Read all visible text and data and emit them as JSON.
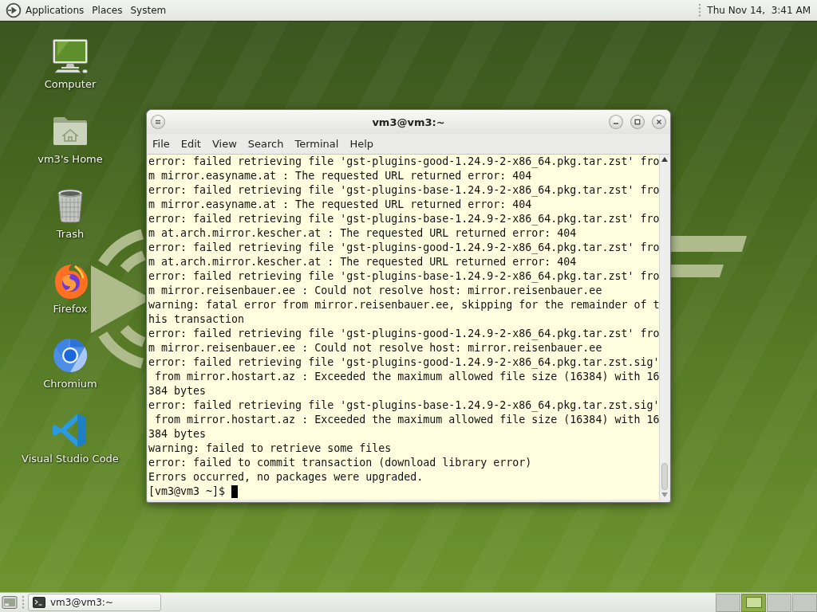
{
  "top_panel": {
    "menus": [
      "Applications",
      "Places",
      "System"
    ],
    "clock": "Thu Nov 14,  3:41 AM"
  },
  "desktop_icons": [
    {
      "kind": "computer",
      "label": "Computer"
    },
    {
      "kind": "home",
      "label": "vm3's Home"
    },
    {
      "kind": "trash",
      "label": "Trash"
    },
    {
      "kind": "firefox",
      "label": "Firefox"
    },
    {
      "kind": "chromium",
      "label": "Chromium"
    },
    {
      "kind": "vscode",
      "label": "Visual Studio Code"
    }
  ],
  "terminal": {
    "title": "vm3@vm3:~",
    "menu": [
      "File",
      "Edit",
      "View",
      "Search",
      "Terminal",
      "Help"
    ],
    "lines": [
      "error: failed retrieving file 'gst-plugins-good-1.24.9-2-x86_64.pkg.tar.zst' fro",
      "m mirror.easyname.at : The requested URL returned error: 404",
      "error: failed retrieving file 'gst-plugins-base-1.24.9-2-x86_64.pkg.tar.zst' fro",
      "m mirror.easyname.at : The requested URL returned error: 404",
      "error: failed retrieving file 'gst-plugins-base-1.24.9-2-x86_64.pkg.tar.zst' fro",
      "m at.arch.mirror.kescher.at : The requested URL returned error: 404",
      "error: failed retrieving file 'gst-plugins-good-1.24.9-2-x86_64.pkg.tar.zst' fro",
      "m at.arch.mirror.kescher.at : The requested URL returned error: 404",
      "error: failed retrieving file 'gst-plugins-base-1.24.9-2-x86_64.pkg.tar.zst' fro",
      "m mirror.reisenbauer.ee : Could not resolve host: mirror.reisenbauer.ee",
      "warning: fatal error from mirror.reisenbauer.ee, skipping for the remainder of t",
      "his transaction",
      "error: failed retrieving file 'gst-plugins-good-1.24.9-2-x86_64.pkg.tar.zst' fro",
      "m mirror.reisenbauer.ee : Could not resolve host: mirror.reisenbauer.ee",
      "error: failed retrieving file 'gst-plugins-good-1.24.9-2-x86_64.pkg.tar.zst.sig'",
      " from mirror.hostart.az : Exceeded the maximum allowed file size (16384) with 16",
      "384 bytes",
      "error: failed retrieving file 'gst-plugins-base-1.24.9-2-x86_64.pkg.tar.zst.sig'",
      " from mirror.hostart.az : Exceeded the maximum allowed file size (16384) with 16",
      "384 bytes",
      "warning: failed to retrieve some files",
      "error: failed to commit transaction (download library error)",
      "Errors occurred, no packages were upgraded."
    ],
    "prompt": "[vm3@vm3 ~]$ "
  },
  "bottom_panel": {
    "tasks": [
      {
        "label": "vm3@vm3:~"
      }
    ],
    "workspaces": [
      {
        "selected": false
      },
      {
        "selected": true
      },
      {
        "selected": false
      },
      {
        "selected": false
      }
    ]
  }
}
